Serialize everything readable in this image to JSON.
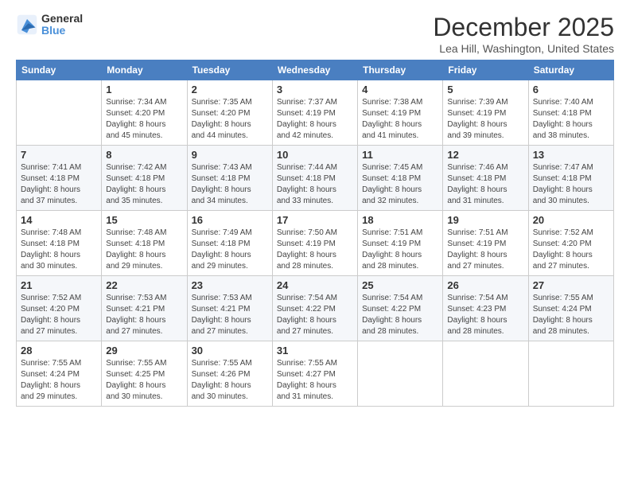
{
  "logo": {
    "line1": "General",
    "line2": "Blue"
  },
  "title": "December 2025",
  "location": "Lea Hill, Washington, United States",
  "days_header": [
    "Sunday",
    "Monday",
    "Tuesday",
    "Wednesday",
    "Thursday",
    "Friday",
    "Saturday"
  ],
  "weeks": [
    [
      {
        "day": "",
        "sunrise": "",
        "sunset": "",
        "daylight": ""
      },
      {
        "day": "1",
        "sunrise": "Sunrise: 7:34 AM",
        "sunset": "Sunset: 4:20 PM",
        "daylight": "Daylight: 8 hours and 45 minutes."
      },
      {
        "day": "2",
        "sunrise": "Sunrise: 7:35 AM",
        "sunset": "Sunset: 4:20 PM",
        "daylight": "Daylight: 8 hours and 44 minutes."
      },
      {
        "day": "3",
        "sunrise": "Sunrise: 7:37 AM",
        "sunset": "Sunset: 4:19 PM",
        "daylight": "Daylight: 8 hours and 42 minutes."
      },
      {
        "day": "4",
        "sunrise": "Sunrise: 7:38 AM",
        "sunset": "Sunset: 4:19 PM",
        "daylight": "Daylight: 8 hours and 41 minutes."
      },
      {
        "day": "5",
        "sunrise": "Sunrise: 7:39 AM",
        "sunset": "Sunset: 4:19 PM",
        "daylight": "Daylight: 8 hours and 39 minutes."
      },
      {
        "day": "6",
        "sunrise": "Sunrise: 7:40 AM",
        "sunset": "Sunset: 4:18 PM",
        "daylight": "Daylight: 8 hours and 38 minutes."
      }
    ],
    [
      {
        "day": "7",
        "sunrise": "Sunrise: 7:41 AM",
        "sunset": "Sunset: 4:18 PM",
        "daylight": "Daylight: 8 hours and 37 minutes."
      },
      {
        "day": "8",
        "sunrise": "Sunrise: 7:42 AM",
        "sunset": "Sunset: 4:18 PM",
        "daylight": "Daylight: 8 hours and 35 minutes."
      },
      {
        "day": "9",
        "sunrise": "Sunrise: 7:43 AM",
        "sunset": "Sunset: 4:18 PM",
        "daylight": "Daylight: 8 hours and 34 minutes."
      },
      {
        "day": "10",
        "sunrise": "Sunrise: 7:44 AM",
        "sunset": "Sunset: 4:18 PM",
        "daylight": "Daylight: 8 hours and 33 minutes."
      },
      {
        "day": "11",
        "sunrise": "Sunrise: 7:45 AM",
        "sunset": "Sunset: 4:18 PM",
        "daylight": "Daylight: 8 hours and 32 minutes."
      },
      {
        "day": "12",
        "sunrise": "Sunrise: 7:46 AM",
        "sunset": "Sunset: 4:18 PM",
        "daylight": "Daylight: 8 hours and 31 minutes."
      },
      {
        "day": "13",
        "sunrise": "Sunrise: 7:47 AM",
        "sunset": "Sunset: 4:18 PM",
        "daylight": "Daylight: 8 hours and 30 minutes."
      }
    ],
    [
      {
        "day": "14",
        "sunrise": "Sunrise: 7:48 AM",
        "sunset": "Sunset: 4:18 PM",
        "daylight": "Daylight: 8 hours and 30 minutes."
      },
      {
        "day": "15",
        "sunrise": "Sunrise: 7:48 AM",
        "sunset": "Sunset: 4:18 PM",
        "daylight": "Daylight: 8 hours and 29 minutes."
      },
      {
        "day": "16",
        "sunrise": "Sunrise: 7:49 AM",
        "sunset": "Sunset: 4:18 PM",
        "daylight": "Daylight: 8 hours and 29 minutes."
      },
      {
        "day": "17",
        "sunrise": "Sunrise: 7:50 AM",
        "sunset": "Sunset: 4:19 PM",
        "daylight": "Daylight: 8 hours and 28 minutes."
      },
      {
        "day": "18",
        "sunrise": "Sunrise: 7:51 AM",
        "sunset": "Sunset: 4:19 PM",
        "daylight": "Daylight: 8 hours and 28 minutes."
      },
      {
        "day": "19",
        "sunrise": "Sunrise: 7:51 AM",
        "sunset": "Sunset: 4:19 PM",
        "daylight": "Daylight: 8 hours and 27 minutes."
      },
      {
        "day": "20",
        "sunrise": "Sunrise: 7:52 AM",
        "sunset": "Sunset: 4:20 PM",
        "daylight": "Daylight: 8 hours and 27 minutes."
      }
    ],
    [
      {
        "day": "21",
        "sunrise": "Sunrise: 7:52 AM",
        "sunset": "Sunset: 4:20 PM",
        "daylight": "Daylight: 8 hours and 27 minutes."
      },
      {
        "day": "22",
        "sunrise": "Sunrise: 7:53 AM",
        "sunset": "Sunset: 4:21 PM",
        "daylight": "Daylight: 8 hours and 27 minutes."
      },
      {
        "day": "23",
        "sunrise": "Sunrise: 7:53 AM",
        "sunset": "Sunset: 4:21 PM",
        "daylight": "Daylight: 8 hours and 27 minutes."
      },
      {
        "day": "24",
        "sunrise": "Sunrise: 7:54 AM",
        "sunset": "Sunset: 4:22 PM",
        "daylight": "Daylight: 8 hours and 27 minutes."
      },
      {
        "day": "25",
        "sunrise": "Sunrise: 7:54 AM",
        "sunset": "Sunset: 4:22 PM",
        "daylight": "Daylight: 8 hours and 28 minutes."
      },
      {
        "day": "26",
        "sunrise": "Sunrise: 7:54 AM",
        "sunset": "Sunset: 4:23 PM",
        "daylight": "Daylight: 8 hours and 28 minutes."
      },
      {
        "day": "27",
        "sunrise": "Sunrise: 7:55 AM",
        "sunset": "Sunset: 4:24 PM",
        "daylight": "Daylight: 8 hours and 28 minutes."
      }
    ],
    [
      {
        "day": "28",
        "sunrise": "Sunrise: 7:55 AM",
        "sunset": "Sunset: 4:24 PM",
        "daylight": "Daylight: 8 hours and 29 minutes."
      },
      {
        "day": "29",
        "sunrise": "Sunrise: 7:55 AM",
        "sunset": "Sunset: 4:25 PM",
        "daylight": "Daylight: 8 hours and 30 minutes."
      },
      {
        "day": "30",
        "sunrise": "Sunrise: 7:55 AM",
        "sunset": "Sunset: 4:26 PM",
        "daylight": "Daylight: 8 hours and 30 minutes."
      },
      {
        "day": "31",
        "sunrise": "Sunrise: 7:55 AM",
        "sunset": "Sunset: 4:27 PM",
        "daylight": "Daylight: 8 hours and 31 minutes."
      },
      {
        "day": "",
        "sunrise": "",
        "sunset": "",
        "daylight": ""
      },
      {
        "day": "",
        "sunrise": "",
        "sunset": "",
        "daylight": ""
      },
      {
        "day": "",
        "sunrise": "",
        "sunset": "",
        "daylight": ""
      }
    ]
  ]
}
